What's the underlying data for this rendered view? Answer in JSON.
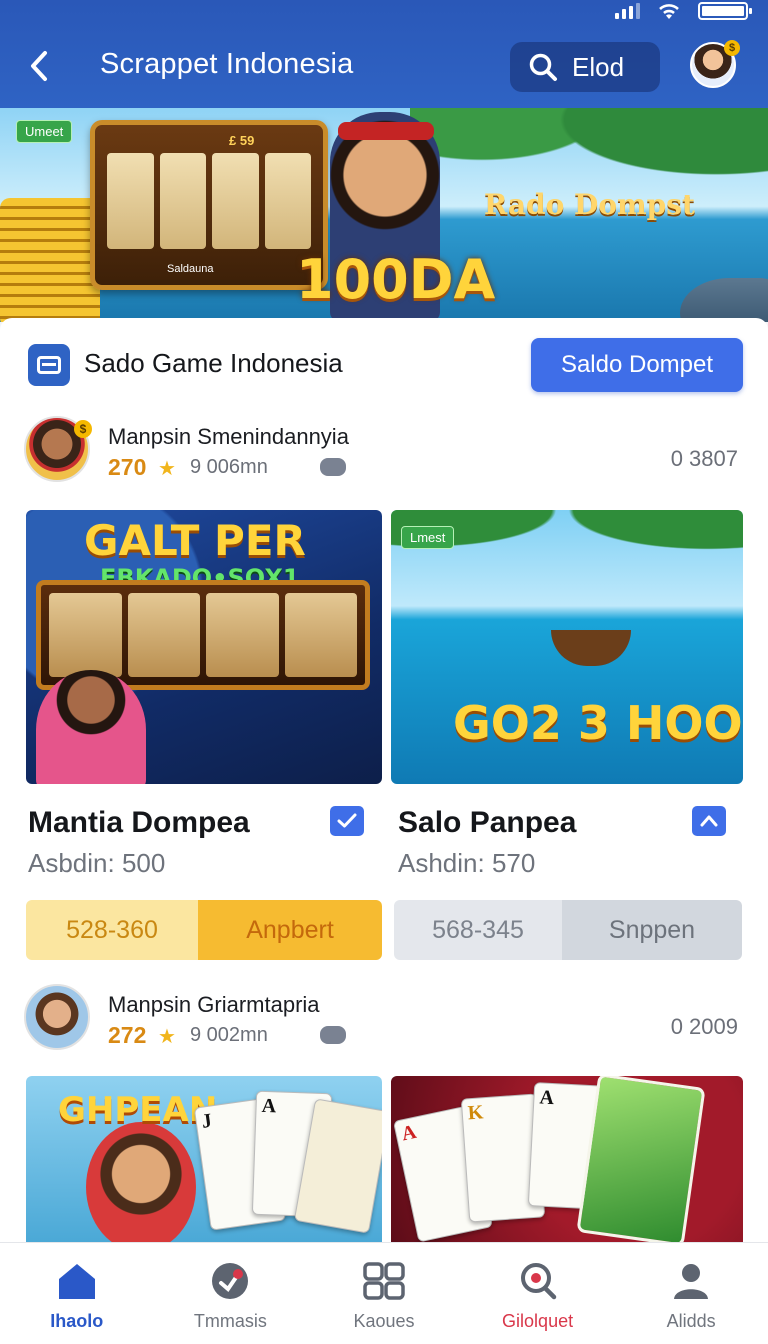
{
  "header": {
    "title": "Scrappet Indonesia",
    "search_label": "Elod",
    "avatar_badge": "$"
  },
  "banner": {
    "tag": "Umeet",
    "slot_amount": "£ 59",
    "slot_label": "Saldauna",
    "side_text": "Rado Dompst",
    "big_text": "100DA"
  },
  "section": {
    "title": "Sado Game Indonesia",
    "action_label": "Saldo Dompet"
  },
  "user_rows": [
    {
      "name": "Manpsin Smenindannyia",
      "points": "270",
      "time": "9 006mn",
      "views": "0 3807"
    },
    {
      "name": "Manpsin Griarmtapria",
      "points": "272",
      "time": "9 002mn",
      "views": "0 2009"
    }
  ],
  "games": [
    {
      "image_title": "GALT PER",
      "image_subtitle": "EBKADO•SOX1",
      "title": "Mantia Dompea",
      "sub": "Asbdin: 500",
      "left_value": "528-360",
      "right_label": "Anpbert",
      "status_icon": "check-icon"
    },
    {
      "image_tag": "Lmest",
      "image_title": "GO2 3 HOO",
      "title": "Salo Panpea",
      "sub": "Ashdin: 570",
      "left_value": "568-345",
      "right_label": "Snppen",
      "status_icon": "chevron-up-icon"
    }
  ],
  "games_row2": [
    {
      "image_title": "GHPEAN"
    },
    {
      "image_title": ""
    }
  ],
  "nav": [
    {
      "label": "Ihaolo",
      "icon": "home-icon",
      "state": "active"
    },
    {
      "label": "Tmmasis",
      "icon": "games-icon",
      "state": "normal"
    },
    {
      "label": "Kaoues",
      "icon": "grid-icon",
      "state": "normal"
    },
    {
      "label": "Gilolquet",
      "icon": "search-icon",
      "state": "hot"
    },
    {
      "label": "Alidds",
      "icon": "profile-icon",
      "state": "normal"
    }
  ],
  "colors": {
    "primary": "#2f63c4",
    "accent": "#3f6ee8",
    "gold": "#f6bb31",
    "hot": "#d9374a"
  }
}
